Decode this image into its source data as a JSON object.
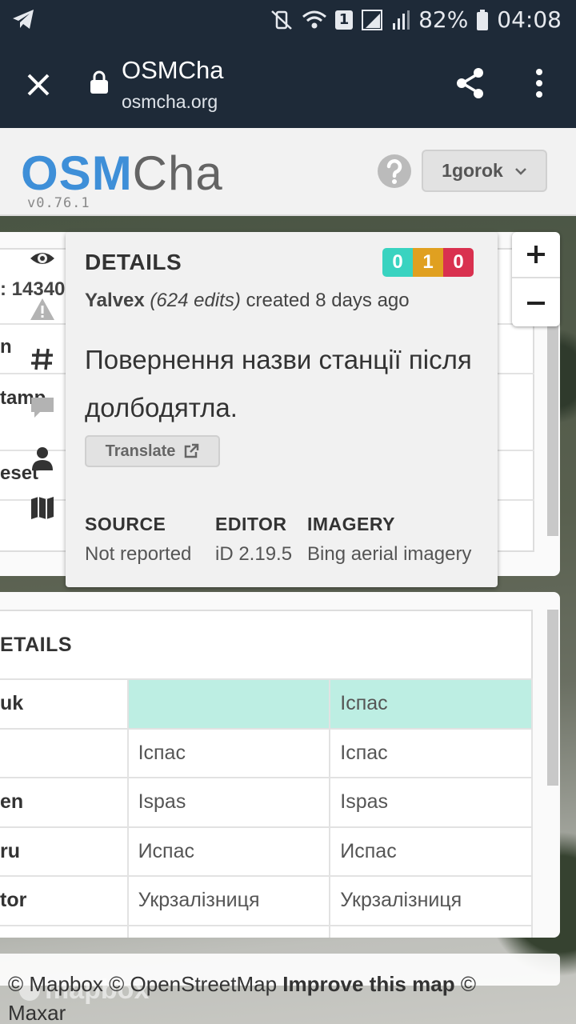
{
  "status_bar": {
    "battery": "82%",
    "time": "04:08",
    "sim": "1"
  },
  "tab": {
    "title": "OSMCha",
    "url": "osmcha.org"
  },
  "app": {
    "logo_primary": "OSM",
    "logo_secondary": "Cha",
    "version": "v0.76.1",
    "user": "1gorok"
  },
  "background_rows": ": 14340",
  "back_list": {
    "id_fragment": ": 14340",
    "rows": [
      "n",
      "tamp",
      "eset"
    ]
  },
  "details": {
    "heading": "DETAILS",
    "counts": {
      "create": "0",
      "modify": "1",
      "delete": "0"
    },
    "count_colors": {
      "create": "#39d3c0",
      "modify": "#e0a020",
      "delete": "#d9314f"
    },
    "username": "Yalvex",
    "edits": "(624 edits)",
    "created": "created 8 days ago",
    "comment": "Повернення назви станції після долбодятла.",
    "translate_label": "Translate",
    "source_label": "SOURCE",
    "source_value": "Not reported",
    "editor_label": "EDITOR",
    "editor_value": "iD 2.19.5",
    "imagery_label": "IMAGERY",
    "imagery_value": "Bing aerial imagery"
  },
  "tags": {
    "title": "ETAILS",
    "rows": [
      {
        "key": "uk",
        "old": "",
        "new": "Іспас"
      },
      {
        "key": "",
        "old": "Іспас",
        "new": "Іспас"
      },
      {
        "key": "en",
        "old": "Ispas",
        "new": "Ispas"
      },
      {
        "key": "ru",
        "old": "Испас",
        "new": "Испас"
      },
      {
        "key": "tor",
        "old": "Укрзалізниця",
        "new": "Укрзалізниця"
      }
    ]
  },
  "attribution": {
    "mapbox": "© Mapbox",
    "osm": "© OpenStreetMap",
    "improve": "Improve this map",
    "maxar": "© Maxar",
    "logo": "mapbox"
  }
}
